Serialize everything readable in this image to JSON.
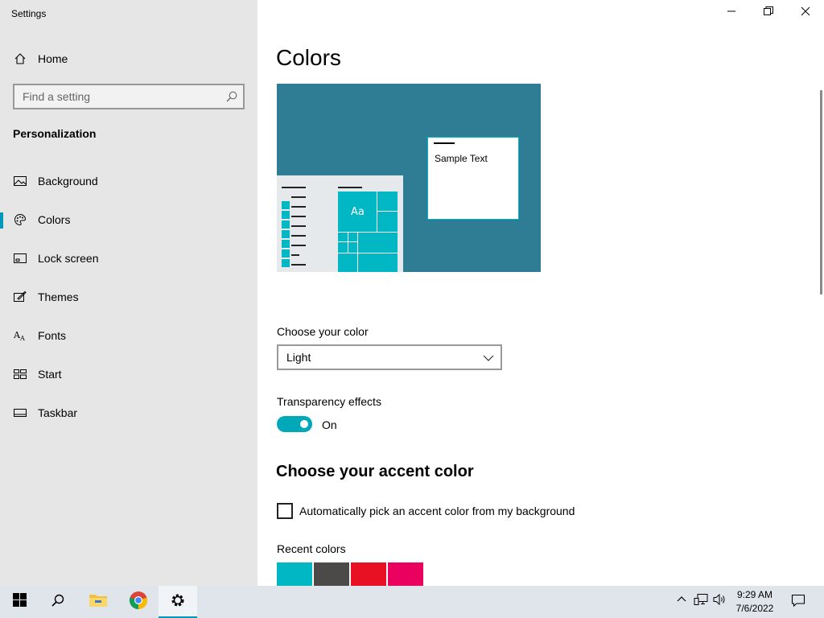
{
  "window": {
    "title": "Settings",
    "controls": {
      "minimize_icon": "minimize-icon",
      "restore_icon": "restore-icon",
      "close_icon": "close-icon"
    }
  },
  "sidebar": {
    "home_label": "Home",
    "search_placeholder": "Find a setting",
    "section_heading": "Personalization",
    "items": [
      {
        "label": "Background",
        "icon": "picture-icon"
      },
      {
        "label": "Colors",
        "icon": "palette-icon",
        "selected": true
      },
      {
        "label": "Lock screen",
        "icon": "lock-screen-icon"
      },
      {
        "label": "Themes",
        "icon": "themes-icon"
      },
      {
        "label": "Fonts",
        "icon": "fonts-icon"
      },
      {
        "label": "Start",
        "icon": "start-icon"
      },
      {
        "label": "Taskbar",
        "icon": "taskbar-icon"
      }
    ]
  },
  "main": {
    "title": "Colors",
    "preview": {
      "tile_text": "Aa",
      "sample_text": "Sample Text"
    },
    "choose_color": {
      "label": "Choose your color",
      "value": "Light"
    },
    "transparency": {
      "label": "Transparency effects",
      "state_label": "On",
      "on": true
    },
    "accent": {
      "heading": "Choose your accent color",
      "auto_pick_label": "Automatically pick an accent color from my background",
      "auto_pick_checked": false,
      "recent_label": "Recent colors",
      "recent_colors": [
        "#00b7c3",
        "#4c4a48",
        "#e81123",
        "#ea005e"
      ]
    }
  },
  "colors": {
    "accent": "#0099bc",
    "sidebar_bg": "#e6e6e6",
    "preview_bg": "#2e7d95",
    "tile": "#00b7c3"
  },
  "taskbar": {
    "buttons": [
      "windows-start-icon",
      "search-icon",
      "file-explorer-icon",
      "chrome-icon",
      "settings-gear-icon"
    ],
    "active": "settings-gear-icon",
    "tray": [
      "chevron-up-icon",
      "network-icon",
      "volume-icon",
      "notification-icon"
    ],
    "time": "9:29 AM",
    "date": "7/6/2022"
  }
}
